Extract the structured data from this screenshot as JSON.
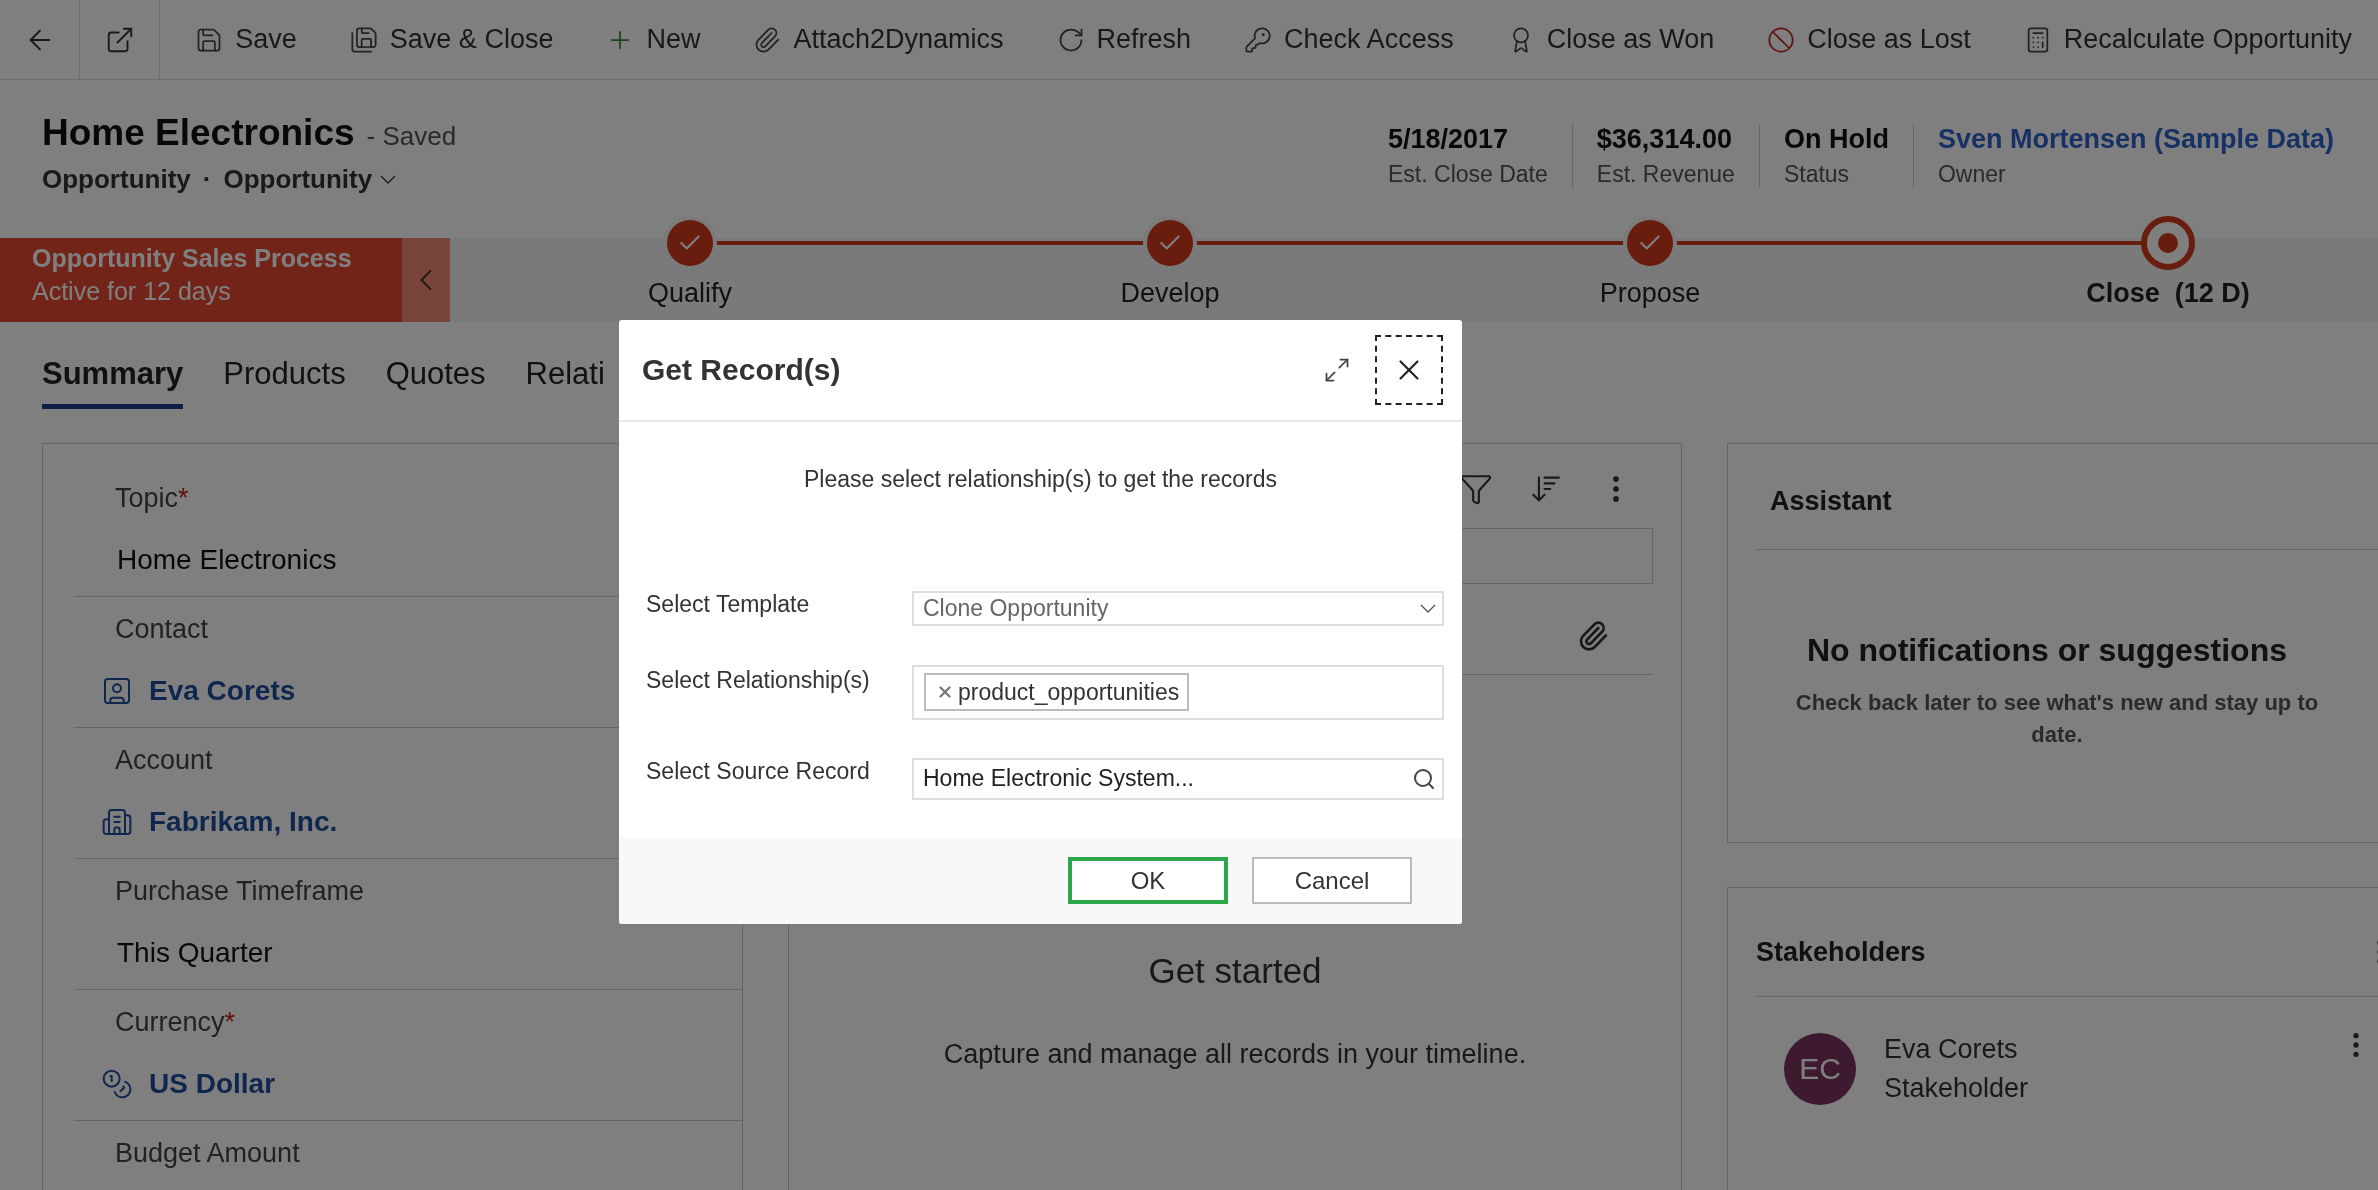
{
  "toolbar": {
    "items": [
      {
        "label": "Save"
      },
      {
        "label": "Save & Close"
      },
      {
        "label": "New"
      },
      {
        "label": "Attach2Dynamics"
      },
      {
        "label": "Refresh"
      },
      {
        "label": "Check Access"
      },
      {
        "label": "Close as Won"
      },
      {
        "label": "Close as Lost"
      },
      {
        "label": "Recalculate Opportunity"
      }
    ]
  },
  "header": {
    "title": "Home Electronics",
    "status": "- Saved",
    "entity": "Opportunity",
    "separator": "·",
    "form": "Opportunity",
    "metrics": [
      {
        "value": "5/18/2017",
        "label": "Est. Close Date",
        "kind": "text"
      },
      {
        "value": "$36,314.00",
        "label": "Est. Revenue",
        "kind": "text"
      },
      {
        "value": "On Hold",
        "label": "Status",
        "kind": "text"
      },
      {
        "value": "Sven Mortensen (Sample Data)",
        "label": "Owner",
        "kind": "link"
      }
    ]
  },
  "process": {
    "name": "Opportunity Sales Process",
    "duration": "Active for 12 days",
    "stages": [
      {
        "label": "Qualify",
        "completed": true,
        "selected": false
      },
      {
        "label": "Develop",
        "completed": true,
        "selected": false
      },
      {
        "label": "Propose",
        "completed": true,
        "selected": false
      },
      {
        "label": "Close  (12 D)",
        "completed": false,
        "selected": true
      }
    ]
  },
  "tabs": [
    {
      "label": "Summary",
      "selected": true
    },
    {
      "label": "Products",
      "selected": false
    },
    {
      "label": "Quotes",
      "selected": false
    },
    {
      "label": "Relati",
      "selected": false
    }
  ],
  "form_fields": [
    {
      "label": "Topic",
      "required_mark": "*",
      "value": "Home Electronics",
      "kind": "text"
    },
    {
      "label": "Contact",
      "value": "Eva Corets",
      "kind": "contact"
    },
    {
      "label": "Account",
      "value": "Fabrikam, Inc.",
      "kind": "account"
    },
    {
      "label": "Purchase Timeframe",
      "value": "This Quarter",
      "kind": "text"
    },
    {
      "label": "Currency",
      "required_mark": "*",
      "value": "US Dollar",
      "kind": "currency"
    },
    {
      "label": "Budget Amount",
      "kind": "text"
    }
  ],
  "timeline": {
    "empty_title": "Get started",
    "empty_text": "Capture and manage all records in your timeline."
  },
  "assistant": {
    "title": "Assistant",
    "empty_title": "No notifications or suggestions",
    "empty_text": "Check back later to see what's new and stay up to date."
  },
  "stakeholders": {
    "title": "Stakeholders",
    "items": [
      {
        "initials": "EC",
        "name": "Eva Corets",
        "role": "Stakeholder"
      }
    ]
  },
  "dialog": {
    "title": "Get Record(s)",
    "message": "Please select relationship(s) to get the records",
    "fields": [
      {
        "label": "Select Template",
        "kind": "select",
        "value": "Clone Opportunity"
      },
      {
        "label": "Select Relationship(s)",
        "kind": "tags",
        "tags": [
          "product_opportunities"
        ]
      },
      {
        "label": "Select Source Record",
        "kind": "lookup",
        "value": "Home Electronic System..."
      }
    ],
    "buttons": [
      {
        "label": "OK",
        "focused": true
      },
      {
        "label": "Cancel",
        "focused": false
      }
    ]
  }
}
